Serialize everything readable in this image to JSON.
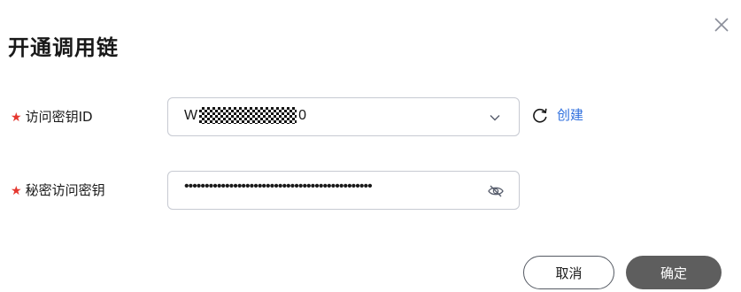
{
  "dialog": {
    "title": "开通调用链",
    "close_icon": "close-icon"
  },
  "form": {
    "access_key": {
      "required_mark": "★",
      "label": "访问密钥ID",
      "value_prefix": "W",
      "value_suffix": "0",
      "masked": true,
      "dropdown_icon": "chevron-down-icon",
      "create_icon": "refresh-icon",
      "create_label": "创建"
    },
    "secret_key": {
      "required_mark": "★",
      "label": "秘密访问密钥",
      "value": "••••••••••••••••••••••••••••••••••••••••••••••",
      "visibility_icon": "eye-off-icon"
    }
  },
  "footer": {
    "cancel_label": "取消",
    "ok_label": "确定"
  },
  "colors": {
    "required": "#e5372f",
    "link": "#2f6fde",
    "primary_button": "#5e5e5e",
    "border": "#c7cad2"
  }
}
